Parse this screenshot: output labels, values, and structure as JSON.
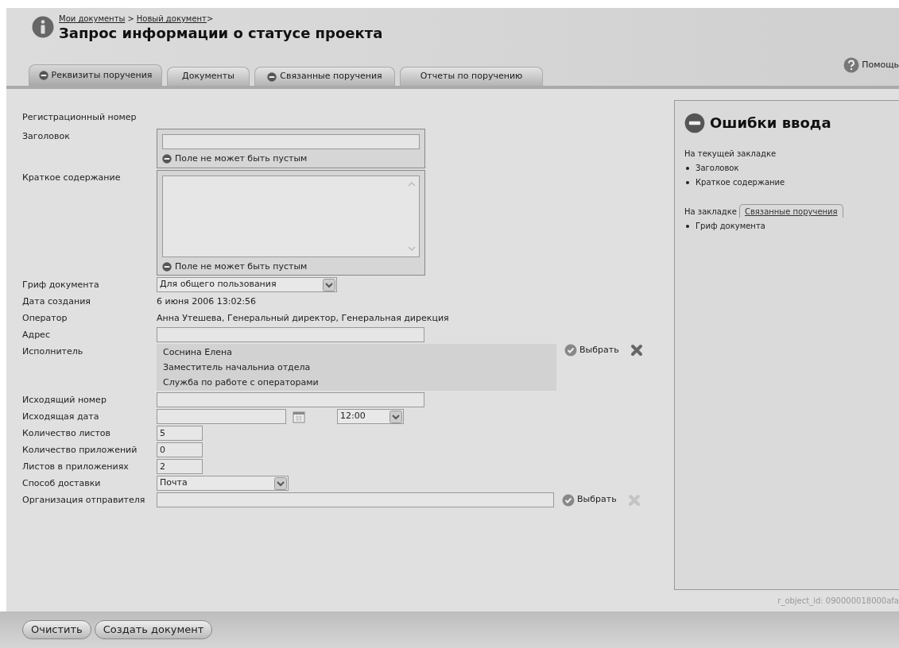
{
  "breadcrumb": {
    "items": [
      "Мои документы",
      "Новый документ"
    ],
    "separators": [
      ">",
      ">"
    ]
  },
  "title": "Запрос информации о статусе проекта",
  "help": "Помощь",
  "tabs": [
    {
      "label": "Реквизиты поручения",
      "selected": true,
      "has_error": true
    },
    {
      "label": "Документы",
      "selected": false,
      "has_error": false
    },
    {
      "label": "Связанные поручения",
      "selected": false,
      "has_error": true
    },
    {
      "label": "Отчеты по поручению",
      "selected": false,
      "has_error": false
    }
  ],
  "fields": [
    {
      "kind": "none",
      "label": "Регистрационный номер"
    },
    {
      "kind": "input",
      "label": "Заголовок",
      "error": "Поле не может быть пустым"
    },
    {
      "kind": "textarea",
      "label": "Краткое содержание",
      "error": "Поле не может быть пустым"
    },
    {
      "kind": "select",
      "label": "Гриф документа",
      "value": "Для общего пользования"
    },
    {
      "kind": "text",
      "label": "Дата создания",
      "value": "6 июня 2006 13:02:56"
    },
    {
      "kind": "text",
      "label": "Оператор",
      "value": "Анна Утешева, Генеральный директор, Генеральная дирекция"
    },
    {
      "kind": "input",
      "label": "Адрес"
    },
    {
      "kind": "lines",
      "label": "Исполнитель",
      "lines": [
        "Соснина Елена",
        "Заместитель начальниа отдела",
        "Служба по работе с операторами"
      ],
      "action": "Выбрать",
      "clear_disabled": false
    },
    {
      "kind": "input",
      "label": "Исходящий номер"
    },
    {
      "kind": "datetime",
      "label": "Исходящая дата",
      "time": "12:00"
    },
    {
      "kind": "small",
      "label": "Количество листов",
      "value": "5"
    },
    {
      "kind": "small",
      "label": "Количество приложений",
      "value": "0"
    },
    {
      "kind": "small",
      "label": "Листов в приложениях",
      "value": "2"
    },
    {
      "kind": "select_short",
      "label": "Способ доставки",
      "value": "Почта"
    },
    {
      "kind": "picker",
      "label": "Организация отправителя",
      "action": "Выбрать",
      "clear_disabled": true
    }
  ],
  "errors": {
    "title": "Ошибки ввода",
    "groups": [
      {
        "heading": "На текущей закладке",
        "items": [
          "Заголовок",
          "Краткое содержание"
        ]
      },
      {
        "heading": "На закладке",
        "tab_link": "Связанные поручения",
        "items": [
          "Гриф документа"
        ]
      }
    ]
  },
  "object_id": "r_object_id: 090000018000afa",
  "buttons": [
    "Очистить",
    "Создать документ"
  ]
}
